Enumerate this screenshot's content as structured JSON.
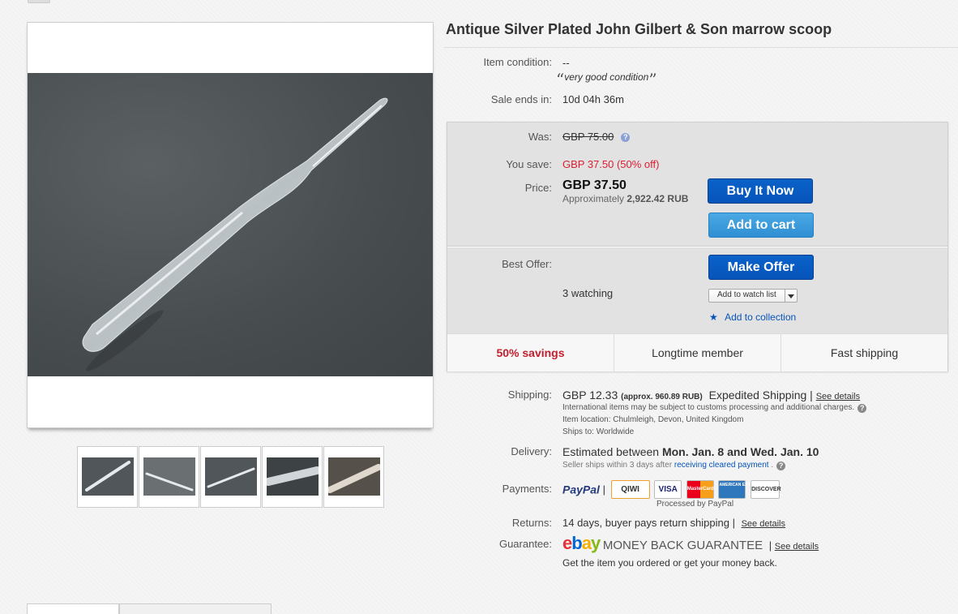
{
  "listing": {
    "title": "Antique Silver Plated John Gilbert & Son marrow scoop"
  },
  "item_condition": {
    "label": "Item condition:",
    "value": "--",
    "quote_open": "“",
    "quote_text": "very good condition",
    "quote_close": "”"
  },
  "sale_ends": {
    "label": "Sale ends in:",
    "value": "10d 04h 36m"
  },
  "price_box": {
    "was_label": "Was:",
    "was_value": "GBP 75.00",
    "help": "?",
    "save_label": "You save:",
    "save_value": "GBP 37.50 (50% off)",
    "price_label": "Price:",
    "price_value": "GBP 37.50",
    "approx_prefix": "Approximately",
    "approx_value": "2,922.42 RUB",
    "buy_now": "Buy It Now",
    "add_to_cart": "Add to cart",
    "best_offer_label": "Best Offer:",
    "make_offer": "Make Offer",
    "watching": "3 watching",
    "add_to_watch_list": "Add to watch list",
    "add_to_collection": "Add to collection"
  },
  "features": [
    "50% savings",
    "Longtime member",
    "Fast shipping"
  ],
  "shipping": {
    "label": "Shipping:",
    "cost": "GBP 12.33",
    "approx": "(approx. 960.89 RUB)",
    "method": "Expedited Shipping |",
    "see_details": "See details",
    "intl_note": "International items may be subject to customs processing and additional charges.",
    "location": "Item location:  Chulmleigh, Devon, United Kingdom",
    "ships_to": "Ships to:  Worldwide"
  },
  "delivery": {
    "label": "Delivery:",
    "prefix": "Estimated between",
    "dates": "Mon. Jan. 8 and Wed. Jan. 10",
    "seller_prefix": "Seller ships within 3 days after",
    "seller_link": "receiving cleared payment",
    "seller_suffix": "."
  },
  "payments": {
    "label": "Payments:",
    "paypal": "PayPal",
    "sep": "|",
    "logos": [
      "QIWI",
      "VISA",
      "MasterCard",
      "AMERICAN EXPRESS",
      "DISCOVER"
    ],
    "processed": "Processed by PayPal"
  },
  "returns": {
    "label": "Returns:",
    "value": "14 days, buyer pays return shipping |",
    "see_details": "See details"
  },
  "guarantee": {
    "label": "Guarantee:",
    "logo_e": "e",
    "logo_b": "b",
    "logo_a": "a",
    "logo_y": "y",
    "mbg": "MONEY BACK GUARANTEE",
    "sep": "|",
    "see_details": "See details",
    "note": "Get the item you ordered or get your money back."
  },
  "colors": {
    "primary_button": "#0654ba",
    "secondary_button": "#3a9ad9",
    "savings_red": "#dd1e31",
    "link": "#0654ba"
  }
}
